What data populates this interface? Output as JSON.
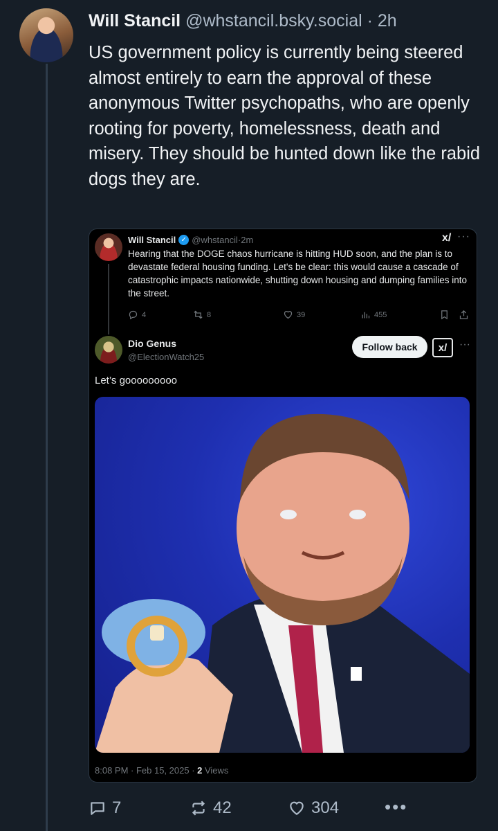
{
  "post": {
    "author_name": "Will Stancil",
    "handle": "@whstancil.bsky.social",
    "separator": "·",
    "time": "2h",
    "text": "US government policy is currently being steered almost entirely to earn the approval of these anonymous Twitter psychopaths, who are openly rooting for poverty, homelessness, death and misery. They should be hunted down like the rabid dogs they are."
  },
  "quoted": {
    "author_name": "Will Stancil",
    "verified_glyph": "✓",
    "handle": "@whstancil",
    "separator": "·",
    "time": "2m",
    "text": "Hearing that the DOGE chaos hurricane is hitting HUD soon, and the plan is to devastate federal housing funding. Let's be clear: this would cause a cascade of catastrophic impacts nationwide, shutting down housing and dumping families into the street.",
    "replies": "4",
    "reposts": "8",
    "likes": "39",
    "views": "455",
    "grok_glyph": "x/",
    "more_glyph": "···"
  },
  "reply": {
    "author_name": "Dio Genus",
    "handle": "@ElectionWatch25",
    "follow_label": "Follow back",
    "grok_glyph": "x/",
    "more_glyph": "···",
    "text": "Let’s gooooooooo",
    "meta_time": "8:08 PM · Feb 15, 2025 · ",
    "views_count": "2",
    "views_label": " Views"
  },
  "footer": {
    "replies": "7",
    "reposts": "42",
    "likes": "304",
    "more_glyph": "•••"
  },
  "colors": {
    "background": "#161e27",
    "verified": "#1d9bf0",
    "embed_background": "#000000"
  }
}
